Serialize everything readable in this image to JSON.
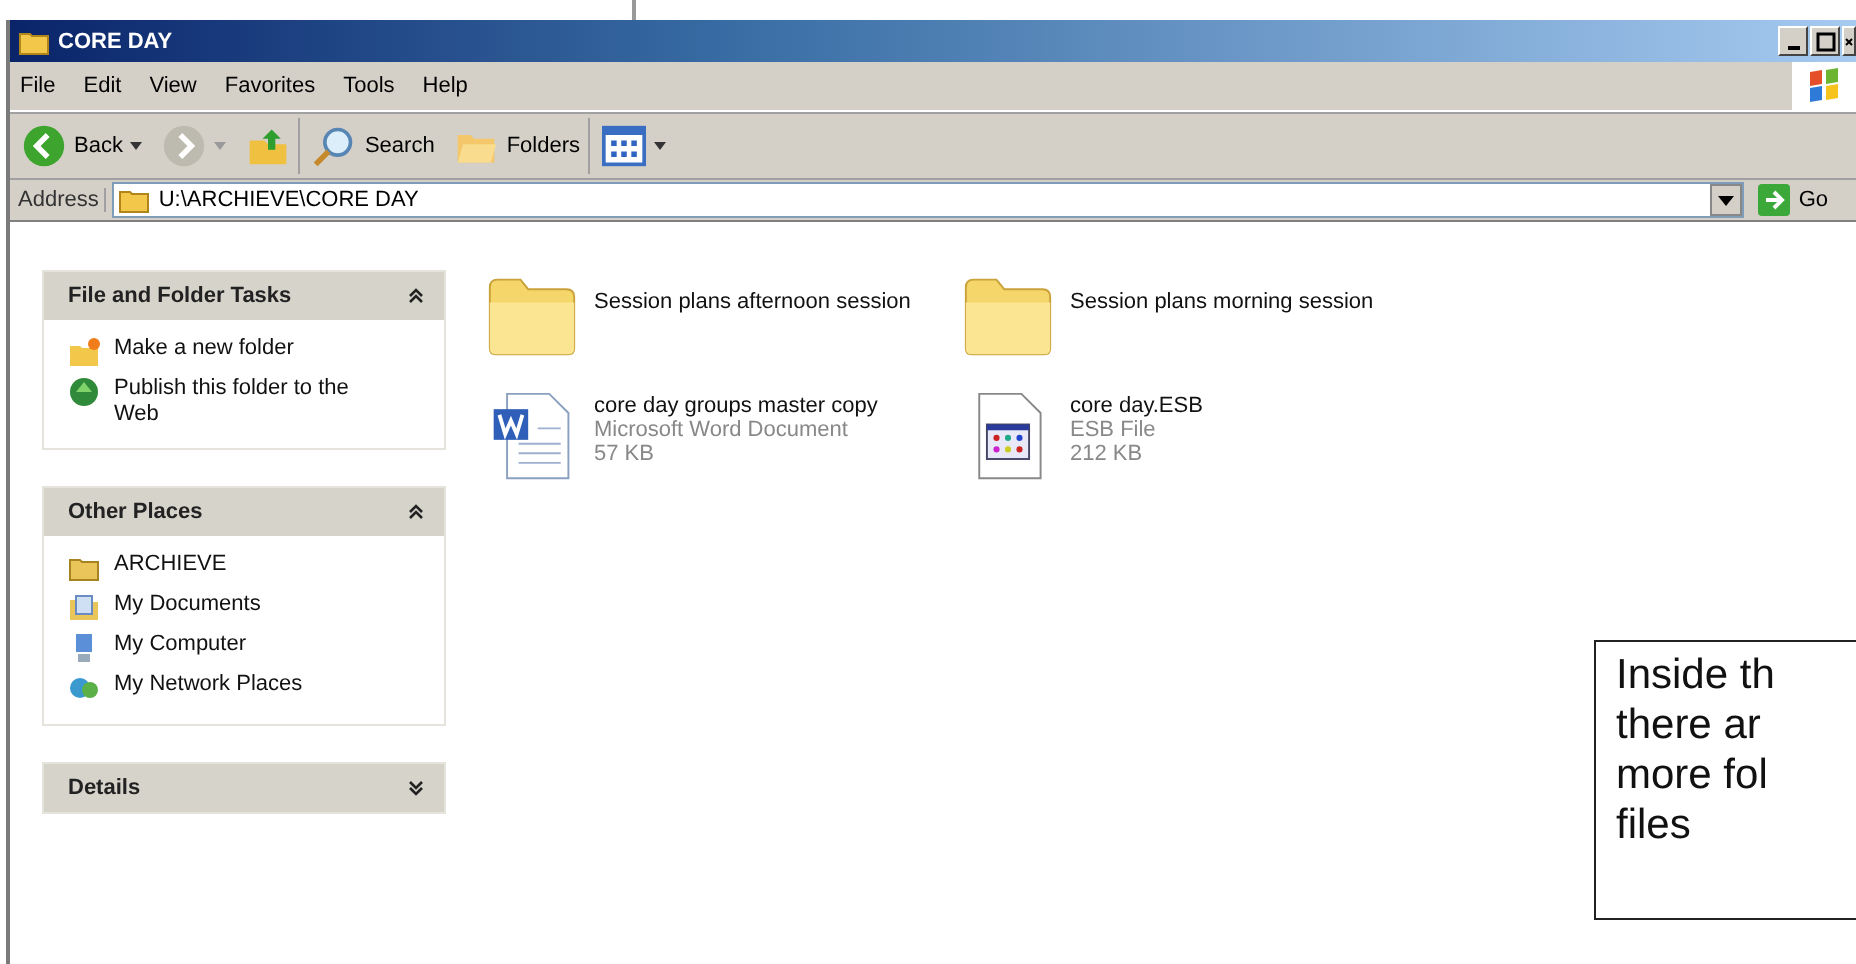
{
  "window": {
    "title": "CORE DAY"
  },
  "menu": [
    "File",
    "Edit",
    "View",
    "Favorites",
    "Tools",
    "Help"
  ],
  "toolbar": [
    {
      "kind": "back",
      "label": "Back"
    },
    {
      "kind": "forward"
    },
    {
      "kind": "up"
    },
    {
      "kind": "search",
      "label": "Search"
    },
    {
      "kind": "folders",
      "label": "Folders"
    },
    {
      "kind": "views"
    }
  ],
  "address": {
    "label": "Address",
    "value": "U:\\ARCHIEVE\\CORE DAY",
    "go": "Go"
  },
  "panels": [
    {
      "title": "File and Folder Tasks",
      "expanded": true,
      "items": [
        {
          "kind": "new-folder",
          "label": "Make a new folder"
        },
        {
          "kind": "publish",
          "label": "Publish this folder to the Web"
        }
      ]
    },
    {
      "title": "Other Places",
      "expanded": true,
      "items": [
        {
          "kind": "folder",
          "label": "ARCHIEVE"
        },
        {
          "kind": "documents",
          "label": "My Documents"
        },
        {
          "kind": "computer",
          "label": "My Computer"
        },
        {
          "kind": "network",
          "label": "My Network Places"
        }
      ]
    },
    {
      "title": "Details",
      "expanded": false
    }
  ],
  "files": [
    {
      "kind": "folder",
      "name": "Session plans afternoon session"
    },
    {
      "kind": "folder",
      "name": "Session plans morning session"
    },
    {
      "kind": "word",
      "name": "core day groups master copy",
      "type": "Microsoft Word Document",
      "size": "57 KB"
    },
    {
      "kind": "esb",
      "name": "core day.ESB",
      "type": "ESB File",
      "size": "212 KB"
    }
  ],
  "callout": {
    "lines": [
      "Inside th",
      "there ar",
      "more fol",
      "files"
    ]
  }
}
